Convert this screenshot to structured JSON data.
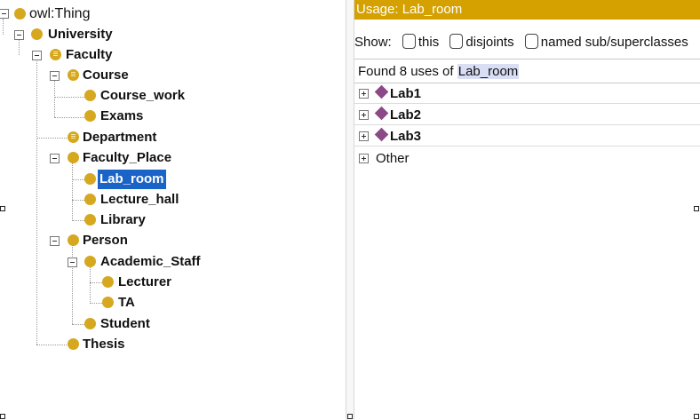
{
  "tree": {
    "nodes": [
      {
        "label": "owl:Thing",
        "plain": true
      },
      {
        "label": "University"
      },
      {
        "label": "Faculty"
      },
      {
        "label": "Course"
      },
      {
        "label": "Course_work"
      },
      {
        "label": "Exams"
      },
      {
        "label": "Department"
      },
      {
        "label": "Faculty_Place"
      },
      {
        "label": "Lab_room",
        "selected": true
      },
      {
        "label": "Lecture_hall"
      },
      {
        "label": "Library"
      },
      {
        "label": "Person"
      },
      {
        "label": "Academic_Staff"
      },
      {
        "label": "Lecturer"
      },
      {
        "label": "TA"
      },
      {
        "label": "Student"
      },
      {
        "label": "Thesis"
      }
    ]
  },
  "usage": {
    "header": "Usage: Lab_room",
    "show_label": "Show:",
    "options": [
      "this",
      "disjoints",
      "named sub/superclasses"
    ],
    "found_prefix": "Found 8 uses of",
    "found_target": "Lab_room",
    "rows": [
      "Lab1",
      "Lab2",
      "Lab3",
      "Other"
    ]
  },
  "colors": {
    "header_bg": "#d4a100",
    "class_icon": "#d6a820",
    "individual_icon": "#8b4a86",
    "selection": "#1a63c7"
  },
  "icons": {
    "class": "class-icon",
    "defined_class": "equivalent-class-icon",
    "individual": "individual-icon",
    "toggle": "expand-collapse-icon"
  }
}
